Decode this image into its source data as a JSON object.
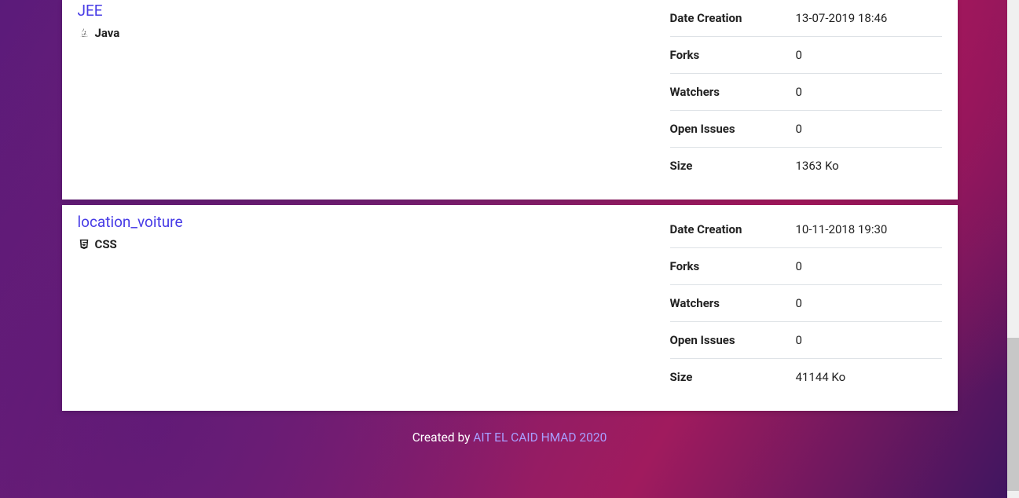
{
  "repos": [
    {
      "title": "JEE",
      "language": "Java",
      "lang_icon": "java",
      "stats": {
        "date_creation_label": "Date Creation",
        "date_creation_value": "13-07-2019 18:46",
        "forks_label": "Forks",
        "forks_value": "0",
        "watchers_label": "Watchers",
        "watchers_value": "0",
        "open_issues_label": "Open Issues",
        "open_issues_value": "0",
        "size_label": "Size",
        "size_value": "1363 Ko"
      }
    },
    {
      "title": "location_voiture",
      "language": "CSS",
      "lang_icon": "css",
      "stats": {
        "date_creation_label": "Date Creation",
        "date_creation_value": "10-11-2018 19:30",
        "forks_label": "Forks",
        "forks_value": "0",
        "watchers_label": "Watchers",
        "watchers_value": "0",
        "open_issues_label": "Open Issues",
        "open_issues_value": "0",
        "size_label": "Size",
        "size_value": "41144 Ko"
      }
    }
  ],
  "footer": {
    "prefix": "Created by ",
    "link_text": "AIT EL CAID HMAD 2020"
  }
}
